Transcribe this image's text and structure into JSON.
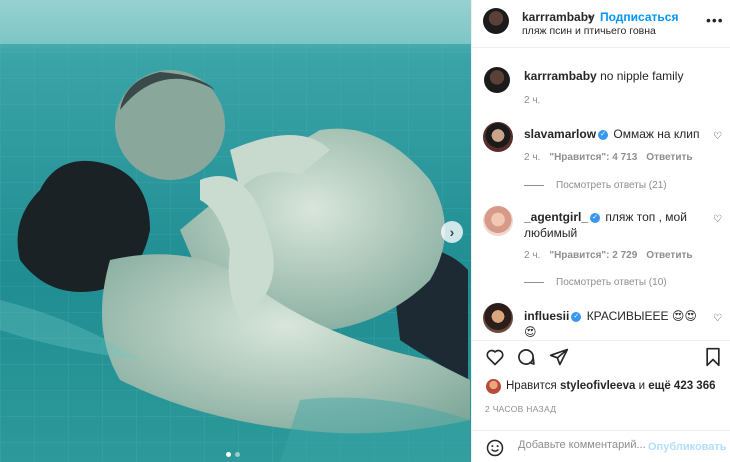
{
  "header": {
    "username": "karrrambaby",
    "separator": "•",
    "follow_label": "Подписаться",
    "location": "пляж псин и птичьего говна",
    "more": "•••"
  },
  "caption": {
    "username": "karrrambaby",
    "text": "no nipple family",
    "time": "2 ч."
  },
  "comments": [
    {
      "username": "slavamarlow",
      "verified": true,
      "text": "Оммаж на клип",
      "time": "2 ч.",
      "likes": "\"Нравится\": 4 713",
      "reply": "Ответить",
      "replies": "Посмотреть ответы (21)"
    },
    {
      "username": "_agentgirl_",
      "verified": true,
      "text": "пляж топ , мой любимый",
      "time": "2 ч.",
      "likes": "\"Нравится\": 2 729",
      "reply": "Ответить",
      "replies": "Посмотреть ответы (10)"
    },
    {
      "username": "influesii",
      "verified": true,
      "text": "КРАСИВЫЕЕЕ 😍😍😍"
    }
  ],
  "likes": {
    "prefix": "Нравится",
    "user": "styleofivleeva",
    "middle": "и",
    "count": "ещё 423 366"
  },
  "post_time": "2 ЧАСОВ НАЗАД",
  "comment_box": {
    "placeholder": "Добавьте комментарий...",
    "publish": "Опубликовать"
  },
  "icons": {
    "next": "chevron-right-icon",
    "like": "heart-icon",
    "comment": "comment-icon",
    "share": "send-icon",
    "save": "bookmark-icon",
    "emoji": "emoji-icon"
  },
  "colors": {
    "accent": "#0095f6",
    "water": "#2a8f93",
    "muted": "#8e8e8e"
  }
}
